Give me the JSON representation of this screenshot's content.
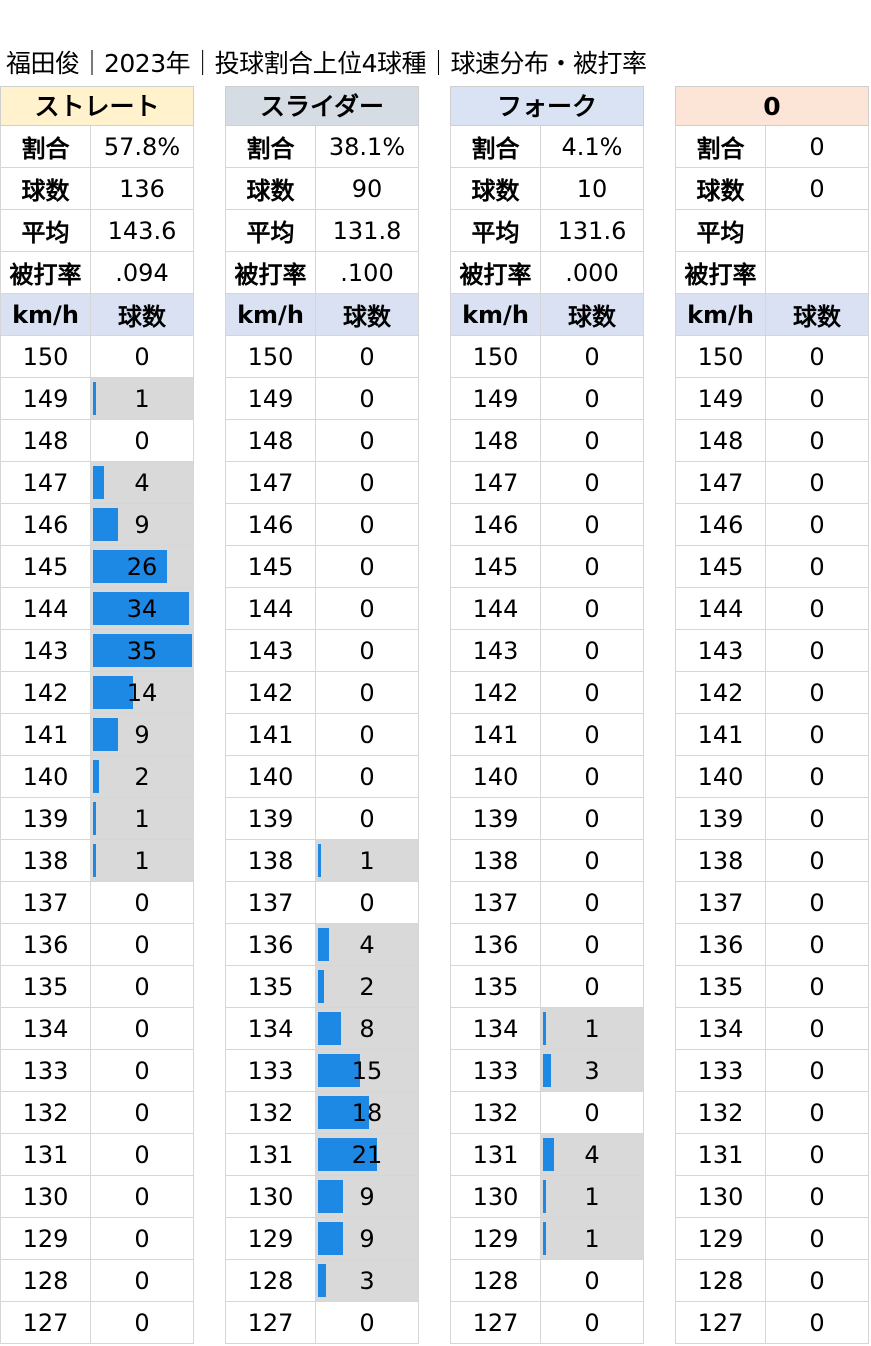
{
  "title": "福田俊｜2023年｜投球割合上位4球種｜球速分布・被打率",
  "labels": {
    "ratio": "割合",
    "count": "球数",
    "avg": "平均",
    "ba": "被打率",
    "kmh": "km/h",
    "pitches": "球数"
  },
  "colors": {
    "straight": "#fff2cc",
    "slider": "#d6dce4",
    "fork": "#dae3f3",
    "other": "#fce4d6",
    "bar": "#1e88e5",
    "barbg": "#d9d9d9",
    "colhdr": "#d9e1f2"
  },
  "chart_data": {
    "type": "bar",
    "categories": [
      150,
      149,
      148,
      147,
      146,
      145,
      144,
      143,
      142,
      141,
      140,
      139,
      138,
      137,
      136,
      135,
      134,
      133,
      132,
      131,
      130,
      129,
      128,
      127
    ],
    "series": [
      {
        "name": "ストレート",
        "ratio": "57.8%",
        "count": "136",
        "avg": "143.6",
        "ba": ".094",
        "values": [
          0,
          1,
          0,
          4,
          9,
          26,
          34,
          35,
          14,
          9,
          2,
          1,
          1,
          0,
          0,
          0,
          0,
          0,
          0,
          0,
          0,
          0,
          0,
          0
        ]
      },
      {
        "name": "スライダー",
        "ratio": "38.1%",
        "count": "90",
        "avg": "131.8",
        "ba": ".100",
        "values": [
          0,
          0,
          0,
          0,
          0,
          0,
          0,
          0,
          0,
          0,
          0,
          0,
          1,
          0,
          4,
          2,
          8,
          15,
          18,
          21,
          9,
          9,
          3,
          0
        ]
      },
      {
        "name": "フォーク",
        "ratio": "4.1%",
        "count": "10",
        "avg": "131.6",
        "ba": ".000",
        "values": [
          0,
          0,
          0,
          0,
          0,
          0,
          0,
          0,
          0,
          0,
          0,
          0,
          0,
          0,
          0,
          0,
          1,
          3,
          0,
          4,
          1,
          1,
          0,
          0
        ]
      },
      {
        "name": "0",
        "ratio": "0",
        "count": "0",
        "avg": "",
        "ba": "",
        "values": [
          0,
          0,
          0,
          0,
          0,
          0,
          0,
          0,
          0,
          0,
          0,
          0,
          0,
          0,
          0,
          0,
          0,
          0,
          0,
          0,
          0,
          0,
          0,
          0
        ]
      }
    ],
    "xlim": [
      0,
      35
    ]
  }
}
